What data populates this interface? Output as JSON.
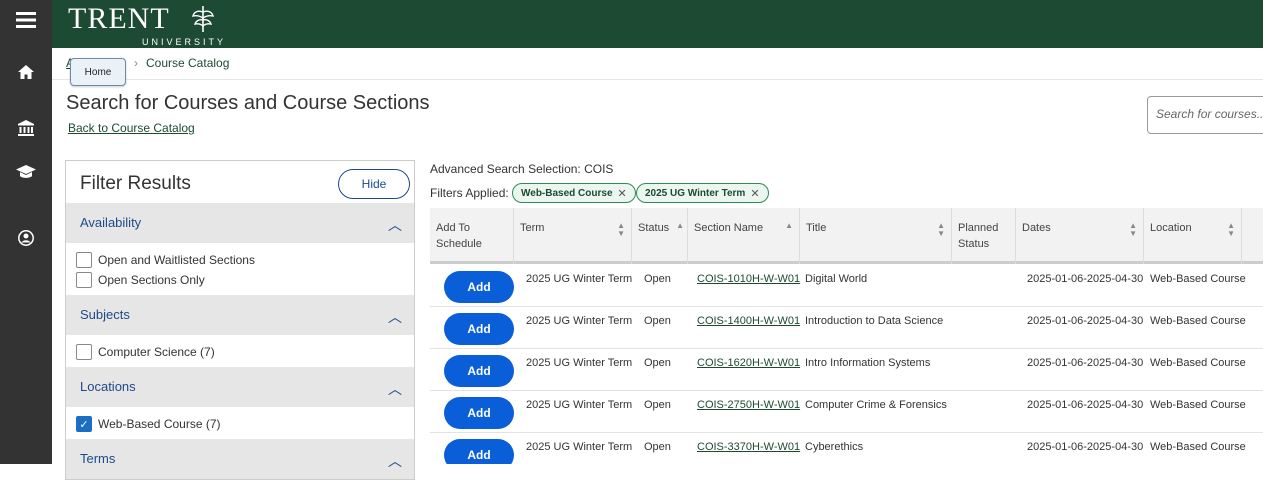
{
  "header": {
    "logo_text": "TRENT",
    "logo_sub": "UNIVERSITY"
  },
  "breadcrumb": {
    "first": "Ad",
    "current": "Course Catalog",
    "tooltip": "Home"
  },
  "page": {
    "title": "Search for Courses and Course Sections",
    "back_link": "Back to Course Catalog"
  },
  "search": {
    "placeholder": "Search for courses..."
  },
  "filter_panel": {
    "title": "Filter Results",
    "hide_label": "Hide",
    "sections": [
      {
        "label": "Availability",
        "options": [
          {
            "label": "Open and Waitlisted Sections",
            "checked": false
          },
          {
            "label": "Open Sections Only",
            "checked": false
          }
        ]
      },
      {
        "label": "Subjects",
        "options": [
          {
            "label": "Computer Science (7)",
            "checked": false
          }
        ]
      },
      {
        "label": "Locations",
        "options": [
          {
            "label": "Web-Based Course (7)",
            "checked": true
          }
        ]
      },
      {
        "label": "Terms",
        "options": []
      }
    ]
  },
  "results": {
    "advanced_selection": "Advanced Search Selection: COIS",
    "filters_applied_label": "Filters Applied:",
    "pills": [
      "Web-Based Course",
      "2025 UG Winter Term"
    ],
    "columns": [
      "Add To Schedule",
      "Term",
      "Status",
      "Section Name",
      "Title",
      "Planned Status",
      "Dates",
      "Location"
    ],
    "add_label": "Add",
    "rows": [
      {
        "term": "2025 UG Winter Term",
        "status": "Open",
        "section": "COIS-1010H-W-W01",
        "title": "Digital World",
        "planned": "",
        "dates": "2025-01-06-2025-04-30",
        "location": "Web-Based Course"
      },
      {
        "term": "2025 UG Winter Term",
        "status": "Open",
        "section": "COIS-1400H-W-W01",
        "title": "Introduction to Data Science",
        "planned": "",
        "dates": "2025-01-06-2025-04-30",
        "location": "Web-Based Course"
      },
      {
        "term": "2025 UG Winter Term",
        "status": "Open",
        "section": "COIS-1620H-W-W01",
        "title": "Intro Information Systems",
        "planned": "",
        "dates": "2025-01-06-2025-04-30",
        "location": "Web-Based Course"
      },
      {
        "term": "2025 UG Winter Term",
        "status": "Open",
        "section": "COIS-2750H-W-W01",
        "title": "Computer Crime & Forensics",
        "planned": "",
        "dates": "2025-01-06-2025-04-30",
        "location": "Web-Based Course"
      },
      {
        "term": "2025 UG Winter Term",
        "status": "Open",
        "section": "COIS-3370H-W-W01",
        "title": "Cyberethics",
        "planned": "",
        "dates": "2025-01-06-2025-04-30",
        "location": "Web-Based Course"
      }
    ]
  },
  "colors": {
    "brand": "#1d4a32",
    "accent": "#0a5fd8",
    "sidebar": "#333333"
  },
  "icons": [
    "menu-icon",
    "home-icon",
    "institution-icon",
    "graduation-cap-icon",
    "user-circle-icon"
  ]
}
